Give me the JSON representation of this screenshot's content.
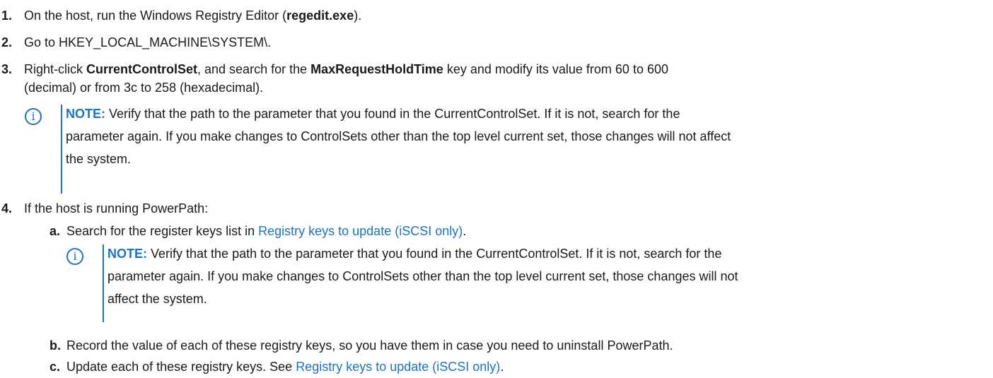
{
  "steps": {
    "s1": {
      "num": "1.",
      "pre": "On the host, run the Windows Registry Editor (",
      "bold": "regedit.exe",
      "post": ")."
    },
    "s2": {
      "num": "2.",
      "text": "Go to HKEY_LOCAL_MACHINE\\SYSTEM\\."
    },
    "s3": {
      "num": "3.",
      "pre": "Right-click ",
      "bold1": "CurrentControlSet",
      "mid": ", and search for the ",
      "bold2": "MaxRequestHoldTime",
      "post": " key and modify its value from 60 to 600",
      "line2": "(decimal) or from 3c to 258 (hexadecimal).",
      "note": {
        "icon": "i",
        "label": "NOTE:",
        "line1": " Verify that the path to the parameter that you found in the CurrentControlSet. If it is not, search for the",
        "line2": "parameter again. If you make changes to ControlSets other than the top level current set, those changes will not affect",
        "line3": "the system."
      }
    },
    "s4": {
      "num": "4.",
      "text": "If the host is running PowerPath:",
      "a": {
        "letter": "a.",
        "pre": "Search for the register keys list in ",
        "link": "Registry keys to update (iSCSI only)",
        "post": ".",
        "note": {
          "icon": "i",
          "label": "NOTE:",
          "line1": " Verify that the path to the parameter that you found in the CurrentControlSet. If it is not, search for the",
          "line2": "parameter again. If you make changes to ControlSets other than the top level current set, those changes will not",
          "line3": "affect the system."
        }
      },
      "b": {
        "letter": "b.",
        "text": "Record the value of each of these registry keys, so you have them in case you need to uninstall PowerPath."
      },
      "c": {
        "letter": "c.",
        "pre": "Update each of these registry keys. See ",
        "link": "Registry keys to update (iSCSI only)",
        "post": "."
      }
    }
  }
}
